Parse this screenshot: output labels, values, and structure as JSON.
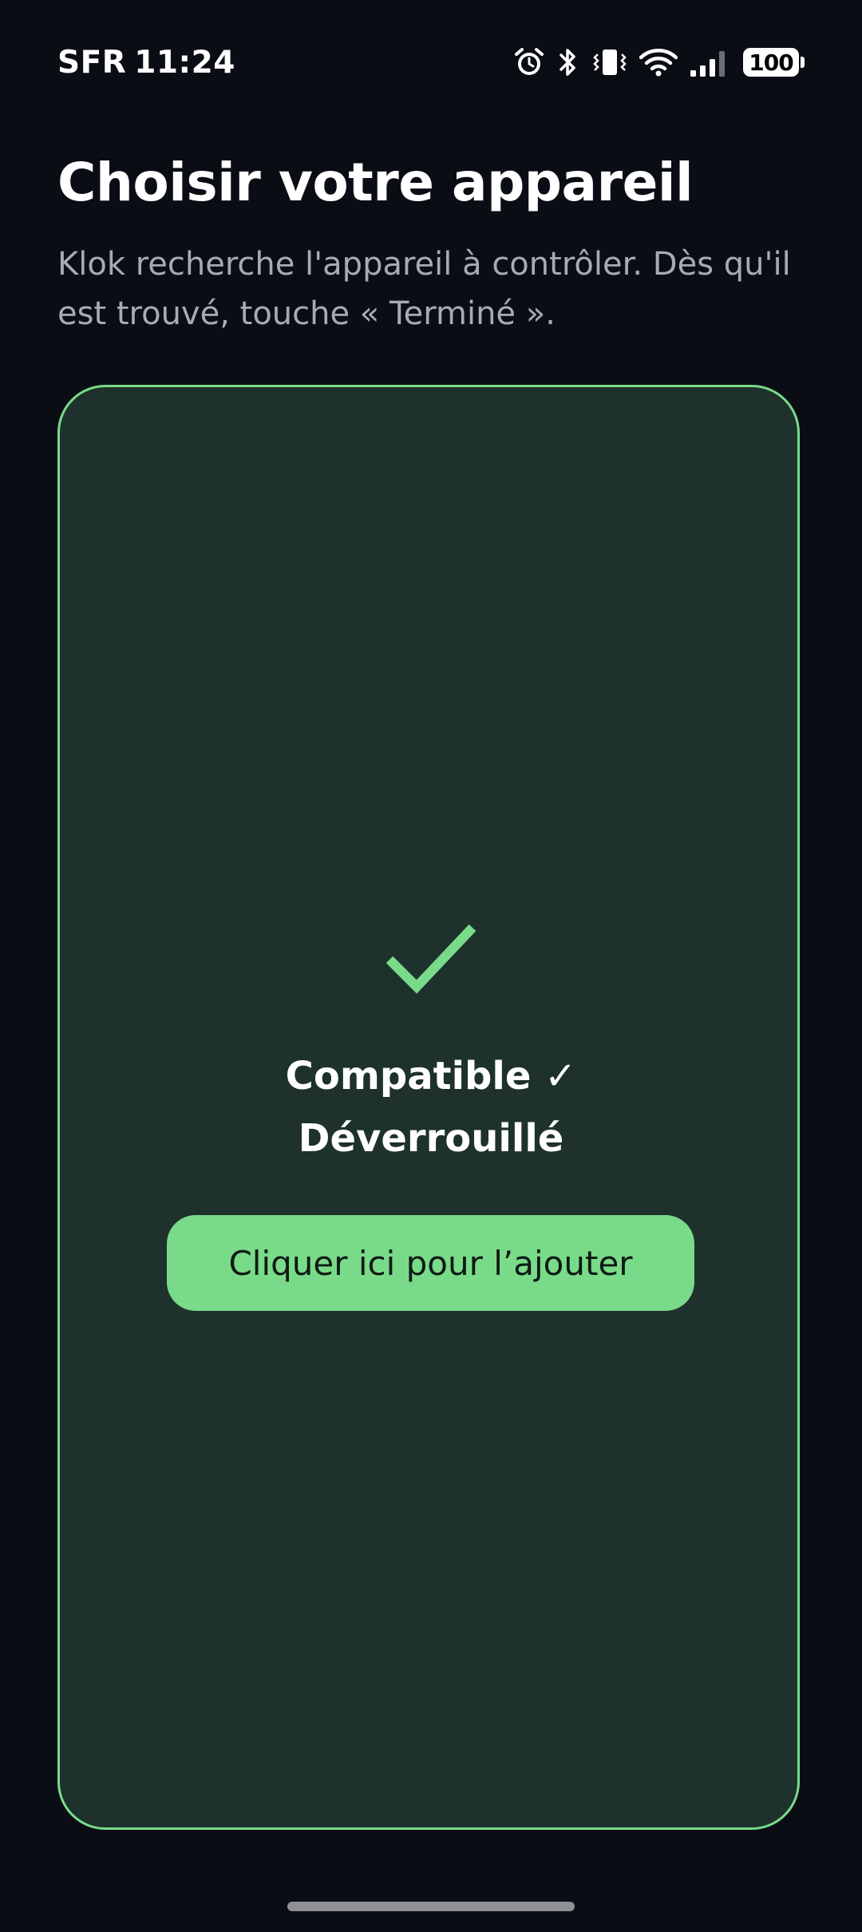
{
  "status_bar": {
    "carrier": "SFR",
    "time": "11:24",
    "battery_level": "100",
    "icons": [
      "alarm-icon",
      "bluetooth-icon",
      "vibrate-icon",
      "wifi-icon",
      "signal-icon",
      "battery-icon"
    ]
  },
  "header": {
    "title": "Choisir votre appareil",
    "subtitle": "Klok recherche l'appareil à contrôler. Dès qu'il est trouvé, touche « Terminé »."
  },
  "device_card": {
    "check_icon": "checkmark-icon",
    "compatible_label": "Compatible ✓",
    "unlocked_label": "Déverrouillé",
    "add_button_label": "Cliquer ici pour l’ajouter"
  },
  "colors": {
    "background": "#0a0d14",
    "card_background": "#1e312c",
    "accent": "#79db89",
    "subtitle_text": "#a7abb5"
  }
}
